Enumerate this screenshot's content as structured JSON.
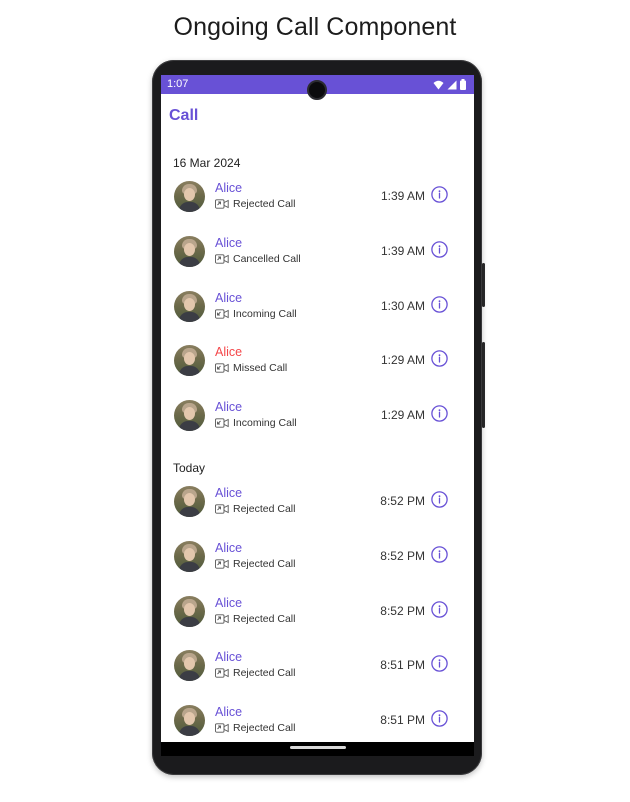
{
  "heading": "Ongoing Call Component",
  "status_bar": {
    "time": "1:07",
    "icons": [
      "wifi-icon",
      "cell-signal-icon",
      "battery-icon"
    ]
  },
  "app_bar": {
    "title": "Call"
  },
  "sections": [
    {
      "header": "16 Mar 2024",
      "calls": [
        {
          "name": "Alice",
          "status": "Rejected Call",
          "time": "1:39 AM",
          "missed": false,
          "direction_icon": "outgoing-video-call-icon"
        },
        {
          "name": "Alice",
          "status": "Cancelled Call",
          "time": "1:39 AM",
          "missed": false,
          "direction_icon": "outgoing-video-call-icon"
        },
        {
          "name": "Alice",
          "status": "Incoming Call",
          "time": "1:30 AM",
          "missed": false,
          "direction_icon": "incoming-video-call-icon"
        },
        {
          "name": "Alice",
          "status": "Missed Call",
          "time": "1:29 AM",
          "missed": true,
          "direction_icon": "incoming-video-call-icon"
        },
        {
          "name": "Alice",
          "status": "Incoming Call",
          "time": "1:29 AM",
          "missed": false,
          "direction_icon": "incoming-video-call-icon"
        }
      ]
    },
    {
      "header": "Today",
      "calls": [
        {
          "name": "Alice",
          "status": "Rejected Call",
          "time": "8:52 PM",
          "missed": false,
          "direction_icon": "outgoing-video-call-icon"
        },
        {
          "name": "Alice",
          "status": "Rejected Call",
          "time": "8:52 PM",
          "missed": false,
          "direction_icon": "outgoing-video-call-icon"
        },
        {
          "name": "Alice",
          "status": "Rejected Call",
          "time": "8:52 PM",
          "missed": false,
          "direction_icon": "outgoing-video-call-icon"
        },
        {
          "name": "Alice",
          "status": "Rejected Call",
          "time": "8:51 PM",
          "missed": false,
          "direction_icon": "outgoing-video-call-icon"
        },
        {
          "name": "Alice",
          "status": "Rejected Call",
          "time": "8:51 PM",
          "missed": false,
          "direction_icon": "outgoing-video-call-icon"
        }
      ]
    }
  ],
  "colors": {
    "accent": "#6851d6",
    "missed": "#f44649"
  }
}
